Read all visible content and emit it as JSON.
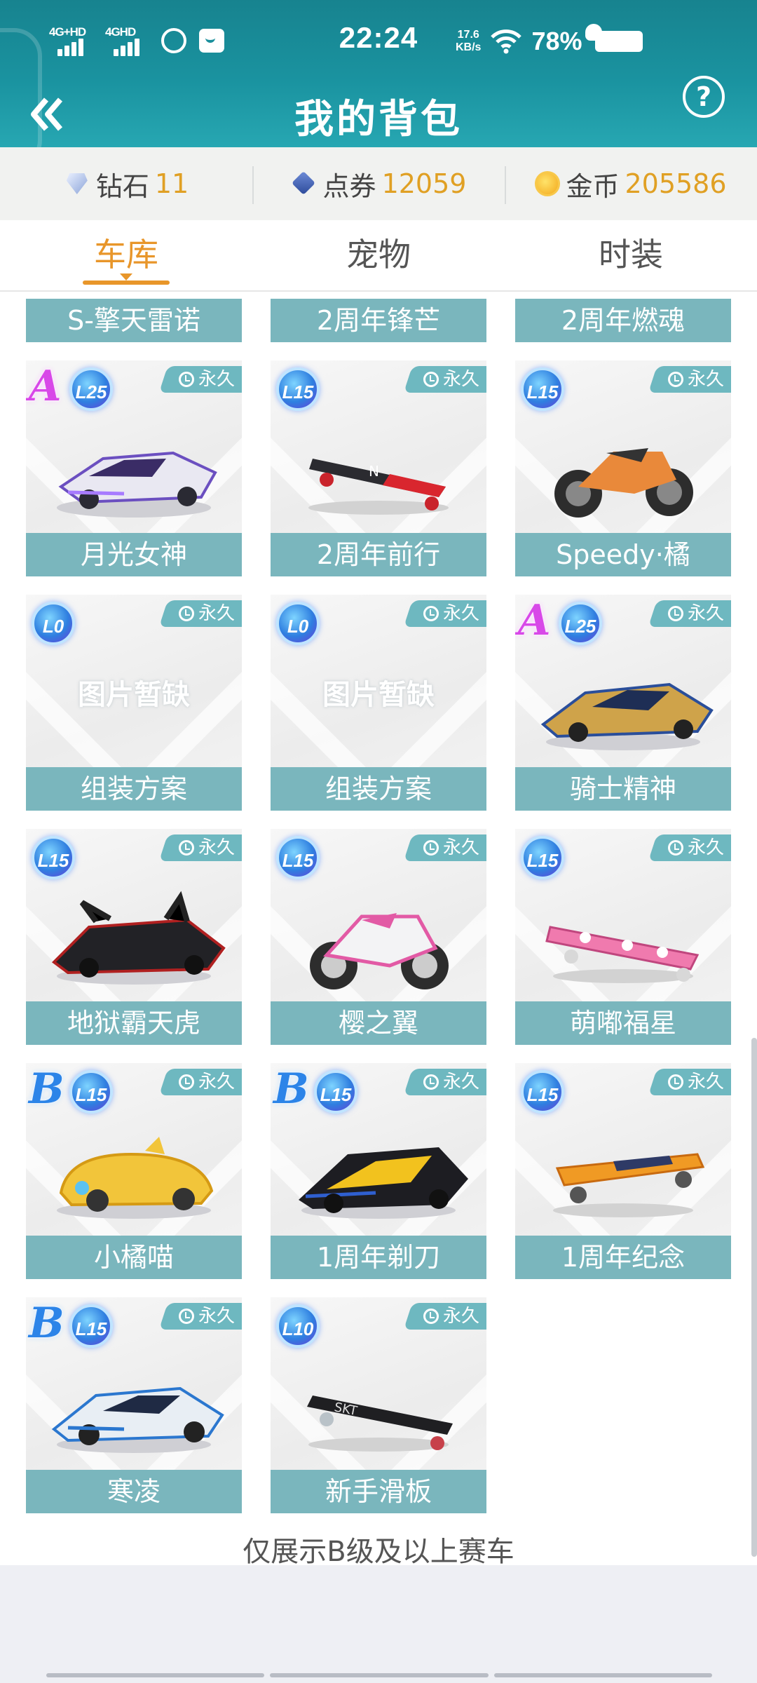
{
  "status_bar": {
    "net1": "4G+HD",
    "net2": "4GHD",
    "time": "22:24",
    "speed_value": "17.6",
    "speed_unit": "KB/s",
    "battery": "78%"
  },
  "header": {
    "title": "我的背包"
  },
  "currency": [
    {
      "label": "钻石",
      "value": "11",
      "icon": "diamond-icon"
    },
    {
      "label": "点券",
      "value": "12059",
      "icon": "coupon-icon"
    },
    {
      "label": "金币",
      "value": "205586",
      "icon": "coin-icon"
    }
  ],
  "tabs": [
    {
      "label": "车库",
      "active": true
    },
    {
      "label": "宠物",
      "active": false
    },
    {
      "label": "时装",
      "active": false
    }
  ],
  "partial_row": [
    "S-擎天雷诺",
    "2周年锋芒",
    "2周年燃魂"
  ],
  "items": [
    {
      "name": "月光女神",
      "rank": "A",
      "level": "L25",
      "perm": "永久",
      "art": "car-purple"
    },
    {
      "name": "2周年前行",
      "rank": "",
      "level": "L15",
      "perm": "永久",
      "art": "board-red"
    },
    {
      "name": "Speedy·橘",
      "rank": "",
      "level": "L15",
      "perm": "永久",
      "art": "moto-orange"
    },
    {
      "name": "组装方案",
      "rank": "",
      "level": "L0",
      "perm": "永久",
      "art": "",
      "placeholder": "图片暂缺"
    },
    {
      "name": "组装方案",
      "rank": "",
      "level": "L0",
      "perm": "永久",
      "art": "",
      "placeholder": "图片暂缺"
    },
    {
      "name": "骑士精神",
      "rank": "A",
      "level": "L25",
      "perm": "永久",
      "art": "car-gold"
    },
    {
      "name": "地狱霸天虎",
      "rank": "",
      "level": "L15",
      "perm": "永久",
      "art": "car-black"
    },
    {
      "name": "樱之翼",
      "rank": "",
      "level": "L15",
      "perm": "永久",
      "art": "moto-pink"
    },
    {
      "name": "萌嘟福星",
      "rank": "",
      "level": "L15",
      "perm": "永久",
      "art": "board-pink"
    },
    {
      "name": "小橘喵",
      "rank": "B",
      "level": "L15",
      "perm": "永久",
      "art": "car-yellow"
    },
    {
      "name": "1周年剃刀",
      "rank": "B",
      "level": "L15",
      "perm": "永久",
      "art": "car-yellowblack"
    },
    {
      "name": "1周年纪念",
      "rank": "",
      "level": "L15",
      "perm": "永久",
      "art": "board-orange"
    },
    {
      "name": "寒凌",
      "rank": "B",
      "level": "L15",
      "perm": "永久",
      "art": "car-white"
    },
    {
      "name": "新手滑板",
      "rank": "",
      "level": "L10",
      "perm": "永久",
      "art": "board-black"
    }
  ],
  "footnote": "仅展示B级及以上赛车",
  "colors": {
    "header_teal": "#1a93a0",
    "accent_orange": "#e8962a",
    "card_label": "#7ab6bd",
    "currency_value": "#e0a024"
  }
}
